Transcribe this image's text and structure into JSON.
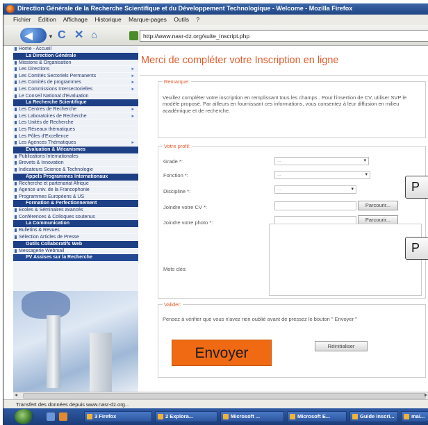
{
  "browser": {
    "window_title": "Direction Générale de la Recherche Scientifique et du Développement Technologique - Welcome - Mozilla Firefox",
    "menu": [
      "Fichier",
      "Édition",
      "Affichage",
      "Historique",
      "Marque-pages",
      "Outils",
      "?"
    ],
    "url": "http://www.nasr-dz.org/suite_inscript.php",
    "status": "Transfert des données depuis www.nasr-dz.org..."
  },
  "sidebar": {
    "top_item": "Home - Accueil",
    "sections": [
      {
        "heading": "La Direction Générale",
        "items": [
          {
            "label": "Missions & Organisation",
            "arrow": ""
          },
          {
            "label": "Les Directions",
            "arrow": "▸"
          },
          {
            "label": "Les Comités Sectoriels Permanents",
            "arrow": "▸"
          },
          {
            "label": "Les Comités de programmes",
            "arrow": "▸"
          },
          {
            "label": "Les Commissions Intersectorielles",
            "arrow": "▸"
          },
          {
            "label": "Le Conseil National d'Evaluation",
            "arrow": ""
          }
        ]
      },
      {
        "heading": "La Recherche Scientifique",
        "items": [
          {
            "label": "Les Centres de Recherche",
            "arrow": "▸"
          },
          {
            "label": "Les Laboratoires de Recherche",
            "arrow": "▸"
          },
          {
            "label": "Les Unités de Recherche",
            "arrow": ""
          },
          {
            "label": "Les Réseaux thématiques",
            "arrow": ""
          },
          {
            "label": "Les Pôles d'Excellence",
            "arrow": ""
          },
          {
            "label": "Les Agences Thématiques",
            "arrow": "▸"
          }
        ]
      },
      {
        "heading": "Evaluation & Mécanismes",
        "items": [
          {
            "label": "Publications Internationales",
            "arrow": ""
          },
          {
            "label": "Brevets & Innovation",
            "arrow": ""
          },
          {
            "label": "Indicateurs Science & Technologie",
            "arrow": ""
          }
        ]
      },
      {
        "heading": "Appels Programmes Internationaux",
        "items": [
          {
            "label": "Recherche et partenariat Afrique",
            "arrow": ""
          },
          {
            "label": "Agence univ. de la Francophonie",
            "arrow": ""
          },
          {
            "label": "Programmes Européens & US",
            "arrow": ""
          }
        ]
      },
      {
        "heading": "Formation & Perfectionnement",
        "items": [
          {
            "label": "Ecoles & Séminaires avancés",
            "arrow": ""
          },
          {
            "label": "Conférences & Colloques soutenus",
            "arrow": ""
          }
        ]
      },
      {
        "heading": "La Communication",
        "items": [
          {
            "label": "Bulletins & Revues",
            "arrow": ""
          },
          {
            "label": "Sélection Articles de Presse",
            "arrow": ""
          }
        ]
      },
      {
        "heading": "Outils Collaboratifs Web",
        "items": [
          {
            "label": "Messagerie Webmail",
            "arrow": ""
          }
        ]
      },
      {
        "heading": "PV Assises sur la Recherche",
        "items": []
      }
    ]
  },
  "page": {
    "title": "Merci de compléter votre Inscription en ligne",
    "remarque": {
      "legend": "Remarque:",
      "text": "Veuillez compléter votre inscription en remplissant tous les champs . Pour l'insertion de CV, utiliser SVP le modèle proposé. Par ailleurs en fournissant ces informations, vous consentez à leur diffusion en milieu académique et de recherche."
    },
    "profil": {
      "legend": "Votre profil:",
      "grade_label": "Grade *:",
      "fonction_label": "Fonction *:",
      "discipline_label": "Discipline *:",
      "cv_label": "Joindre votre CV *:",
      "photo_label": "Joindre votre photo *:",
      "motscles_label": "Mots clés:",
      "select_placeholder": "...",
      "browse_label": "Parcourir...",
      "overlay_button_1": "P",
      "overlay_button_2": "P"
    },
    "valider": {
      "legend": "Valider:",
      "text": "Pensez à vérifier que vous n'avez rien oublié avant de pressez le bouton \" Envoyer \"",
      "submit_label": "Envoyer",
      "reset_label": "Réinitialiser"
    }
  },
  "taskbar": {
    "tasks": [
      "3 Firefox",
      "2 Explora...",
      "Microsoft ...",
      "Microsoft E...",
      "Guide inscri...",
      "mai..."
    ]
  }
}
